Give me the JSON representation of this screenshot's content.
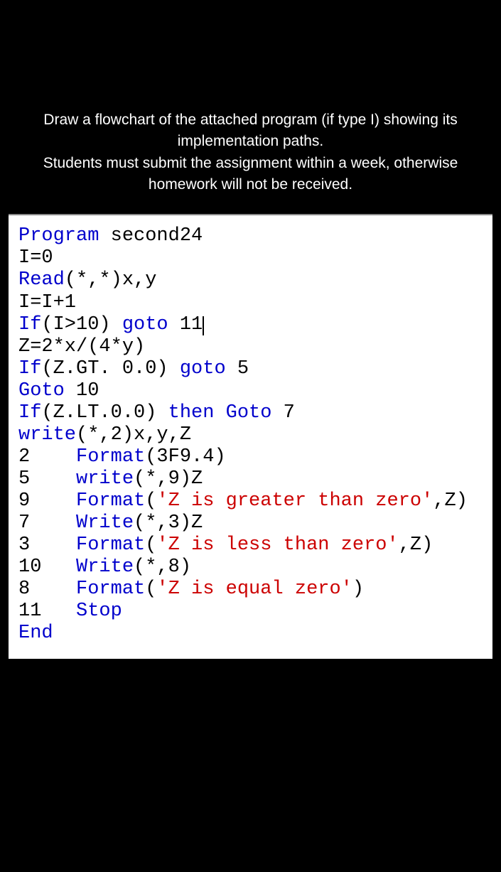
{
  "instructions": {
    "line1": "Draw a flowchart of the attached program (if type I) showing its",
    "line2": "implementation paths.",
    "line3": "Students must submit the assignment within a week, otherwise",
    "line4": "homework will not be received."
  },
  "code": {
    "l01_a": "Program",
    "l01_b": " second24",
    "l02": "I=0",
    "l03_a": "Read",
    "l03_b": "(*,*)x,y",
    "l04": "I=I+1",
    "l05_a": "If",
    "l05_b": "(I>10) ",
    "l05_c": "goto",
    "l05_d": " 11",
    "l06": "Z=2*x/(4*y)",
    "l07_a": "If",
    "l07_b": "(Z.GT. 0.0) ",
    "l07_c": "goto",
    "l07_d": " 5",
    "l08_a": "Goto",
    "l08_b": " 10",
    "l09_a": "If",
    "l09_b": "(Z.LT.0.0) ",
    "l09_c": "then",
    "l09_d": " ",
    "l09_e": "Goto",
    "l09_f": " 7",
    "l10_a": "write",
    "l10_b": "(*,2)x,y,Z",
    "l11_a": "2    ",
    "l11_b": "Format",
    "l11_c": "(3F9.4)",
    "l12_a": "5    ",
    "l12_b": "write",
    "l12_c": "(*,9)Z",
    "l13_a": "9    ",
    "l13_b": "Format",
    "l13_c": "(",
    "l13_d": "'Z is greater than zero'",
    "l13_e": ",Z)",
    "l14_a": "7    ",
    "l14_b": "Write",
    "l14_c": "(*,3)Z",
    "l15_a": "3    ",
    "l15_b": "Format",
    "l15_c": "(",
    "l15_d": "'Z is less than zero'",
    "l15_e": ",Z)",
    "l16_a": "10   ",
    "l16_b": "Write",
    "l16_c": "(*,8)",
    "l17_a": "8    ",
    "l17_b": "Format",
    "l17_c": "(",
    "l17_d": "'Z is equal zero'",
    "l17_e": ")",
    "l18_a": "11   ",
    "l18_b": "Stop",
    "l19": "End"
  }
}
